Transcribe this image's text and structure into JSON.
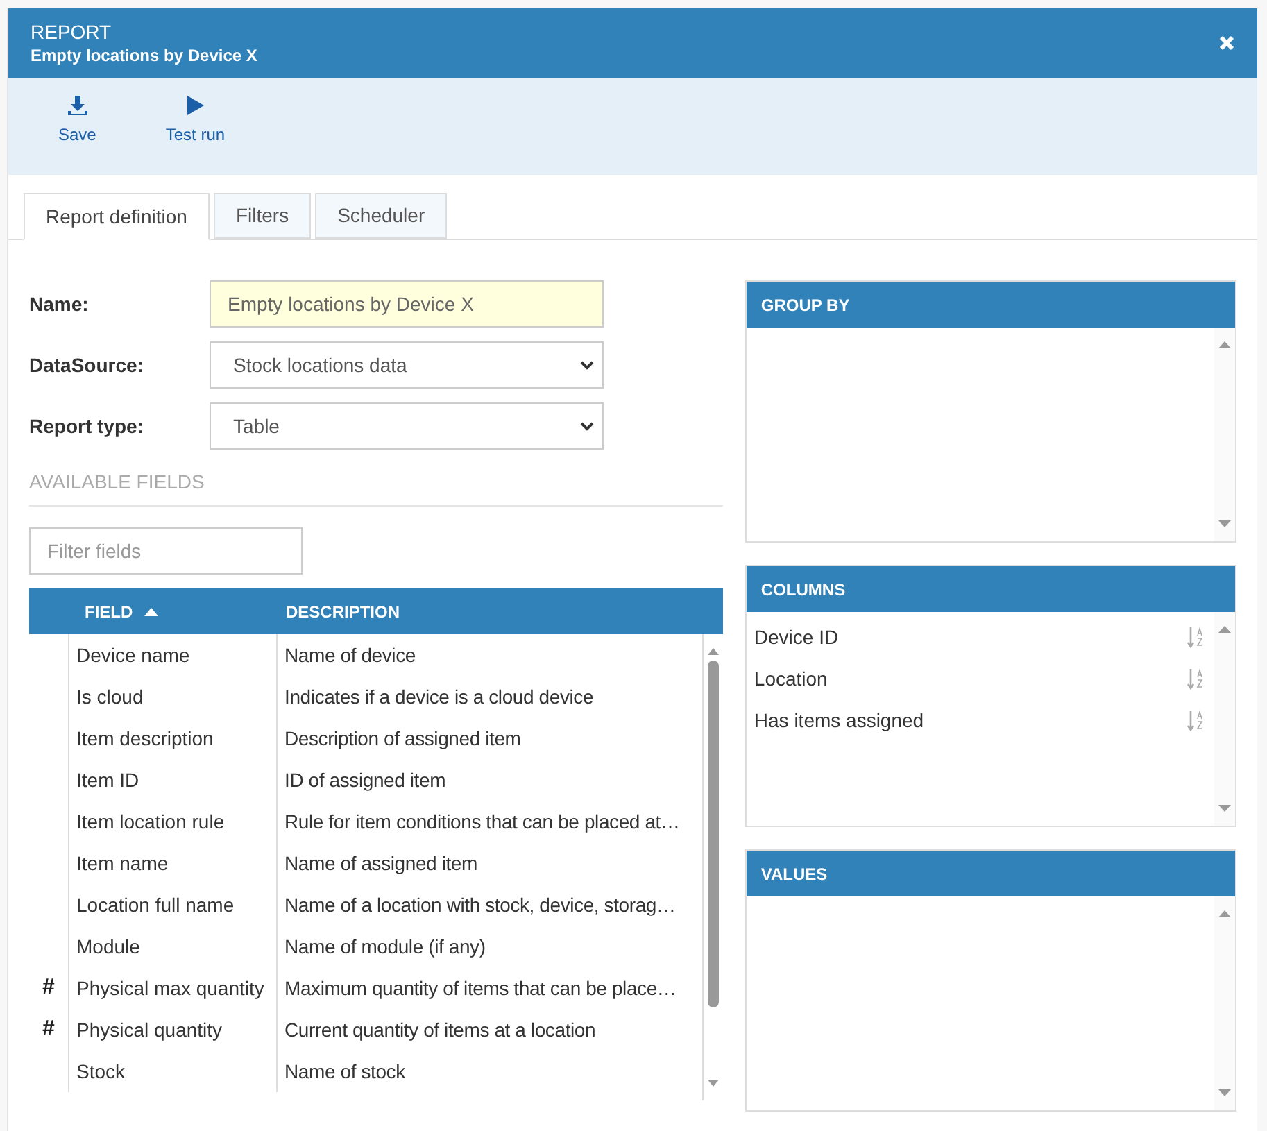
{
  "window": {
    "title": "REPORT",
    "subtitle": "Empty locations by Device X"
  },
  "toolbar": [
    {
      "kind": "save",
      "label": "Save"
    },
    {
      "kind": "run",
      "label": "Test run"
    }
  ],
  "tabs": [
    {
      "label": "Report definition",
      "selected": true
    },
    {
      "label": "Filters",
      "selected": false
    },
    {
      "label": "Scheduler",
      "selected": false
    }
  ],
  "form": [
    {
      "kind": "text",
      "label": "Name:",
      "value": "Empty locations by Device X"
    },
    {
      "kind": "select",
      "label": "DataSource:",
      "value": "Stock locations data"
    },
    {
      "kind": "select",
      "label": "Report type:",
      "value": "Table"
    }
  ],
  "available_fields": {
    "title": "AVAILABLE FIELDS",
    "filter": {
      "placeholder": "Filter fields"
    },
    "columns": [
      {
        "label": "FIELD",
        "sorted": true
      },
      {
        "label": "DESCRIPTION",
        "sorted": false
      }
    ],
    "rows": [
      {
        "kind": "text",
        "field": "Device name",
        "description": "Name of device"
      },
      {
        "kind": "text",
        "field": "Is cloud",
        "description": "Indicates if a device is a cloud device"
      },
      {
        "kind": "text",
        "field": "Item description",
        "description": "Description of assigned item"
      },
      {
        "kind": "text",
        "field": "Item ID",
        "description": "ID of assigned item"
      },
      {
        "kind": "text",
        "field": "Item location rule",
        "description": "Rule for item conditions that can be placed at…"
      },
      {
        "kind": "text",
        "field": "Item name",
        "description": "Name of assigned item"
      },
      {
        "kind": "text",
        "field": "Location full name",
        "description": "Name of a location with stock, device, storag…"
      },
      {
        "kind": "text",
        "field": "Module",
        "description": "Name of module (if any)"
      },
      {
        "kind": "numeric",
        "marker": "#",
        "field": "Physical max quantity",
        "description": "Maximum quantity of items that can be place…"
      },
      {
        "kind": "numeric",
        "marker": "#",
        "field": "Physical quantity",
        "description": "Current quantity of items at a location"
      },
      {
        "kind": "text",
        "field": "Stock",
        "description": "Name of stock"
      }
    ]
  },
  "panels": [
    {
      "title": "GROUP BY"
    },
    {
      "title": "COLUMNS",
      "items": [
        {
          "label": "Device ID"
        },
        {
          "label": "Location"
        },
        {
          "label": "Has items assigned"
        }
      ]
    },
    {
      "title": "VALUES"
    }
  ]
}
